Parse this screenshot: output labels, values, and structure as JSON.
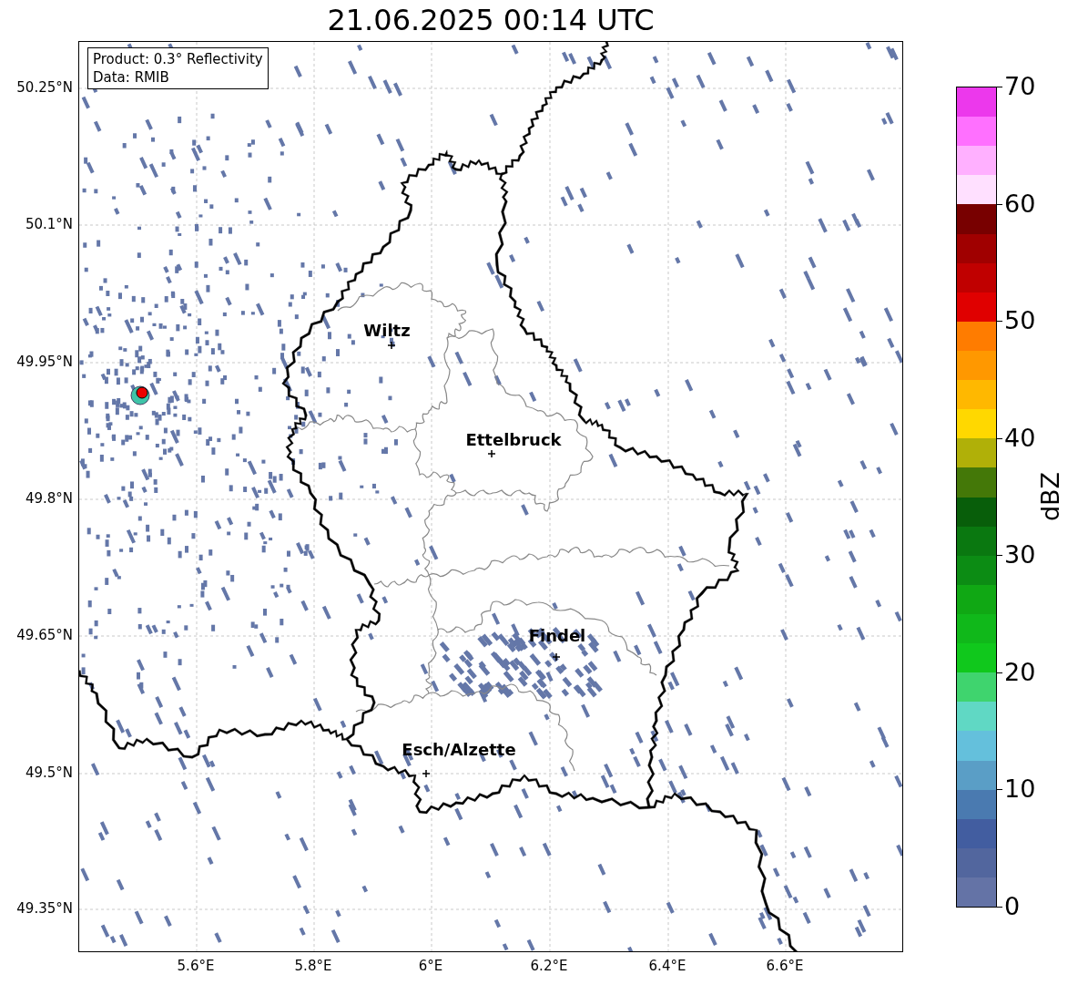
{
  "title": "21.06.2025 00:14 UTC",
  "info_box": [
    "Product: 0.3° Reflectivity",
    "Data: RMIB"
  ],
  "y_ticks": [
    "50.25°N",
    "50.1°N",
    "49.95°N",
    "49.8°N",
    "49.65°N",
    "49.5°N",
    "49.35°N"
  ],
  "x_ticks": [
    "5.6°E",
    "5.8°E",
    "6°E",
    "6.2°E",
    "6.4°E",
    "6.6°E"
  ],
  "cities": [
    {
      "name": "Wiltz"
    },
    {
      "name": "Ettelbruck"
    },
    {
      "name": "Findel"
    },
    {
      "name": "Esch/Alzette"
    }
  ],
  "colorbar": {
    "label": "dBZ",
    "ticks": [
      "70",
      "60",
      "50",
      "40",
      "30",
      "20",
      "10",
      "0"
    ],
    "steps": [
      {
        "color": "#ec38ec"
      },
      {
        "color": "#ff70ff"
      },
      {
        "color": "#ffb0ff"
      },
      {
        "color": "#ffe0ff"
      },
      {
        "color": "#780000"
      },
      {
        "color": "#a00000"
      },
      {
        "color": "#c00000"
      },
      {
        "color": "#e00000"
      },
      {
        "color": "#ff7c00"
      },
      {
        "color": "#ff9800"
      },
      {
        "color": "#ffb800"
      },
      {
        "color": "#ffd800"
      },
      {
        "color": "#b0b008"
      },
      {
        "color": "#447808"
      },
      {
        "color": "#085e0a"
      },
      {
        "color": "#0a7810"
      },
      {
        "color": "#0c8c14"
      },
      {
        "color": "#10a814"
      },
      {
        "color": "#10b81a"
      },
      {
        "color": "#10c81c"
      },
      {
        "color": "#3fd46e"
      },
      {
        "color": "#60d8c4"
      },
      {
        "color": "#64c0dc"
      },
      {
        "color": "#5a9ec6"
      },
      {
        "color": "#4a7ab0"
      },
      {
        "color": "#425da0"
      },
      {
        "color": "#52669e"
      },
      {
        "color": "#6473a6"
      }
    ]
  }
}
